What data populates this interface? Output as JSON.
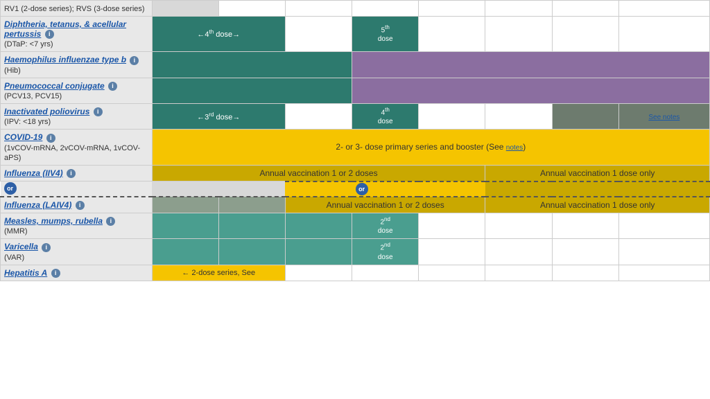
{
  "rows": [
    {
      "id": "rv",
      "vaccine_name": null,
      "vaccine_subtext": "RV1 (2-dose series); RVS (3-dose series)",
      "is_link": false,
      "cells": [
        {
          "bg": "grey-row",
          "text": "",
          "colspan": 1
        },
        {
          "bg": "empty",
          "text": "",
          "colspan": 1
        },
        {
          "bg": "empty",
          "text": "",
          "colspan": 1
        },
        {
          "bg": "empty",
          "text": "",
          "colspan": 1
        },
        {
          "bg": "empty",
          "text": "",
          "colspan": 1
        },
        {
          "bg": "empty",
          "text": "",
          "colspan": 1
        },
        {
          "bg": "empty",
          "text": "",
          "colspan": 1
        },
        {
          "bg": "empty",
          "text": "",
          "colspan": 1
        },
        {
          "bg": "empty",
          "text": "",
          "colspan": 1
        }
      ]
    },
    {
      "id": "dtap",
      "vaccine_name": "Diphtheria, tetanus, & acellular pertussis",
      "vaccine_subtext": "(DTaP: <7 yrs)",
      "is_link": true,
      "has_info": true,
      "cells": [
        {
          "bg": "teal-dark",
          "text": "←4th dose→",
          "colspan": 2,
          "extra_sup": "th",
          "extra_num": "4"
        },
        {
          "bg": "empty",
          "text": "",
          "colspan": 1
        },
        {
          "bg": "teal-dark",
          "text": "5th dose",
          "colspan": 1,
          "dose_label": true
        },
        {
          "bg": "empty",
          "text": "",
          "colspan": 1
        },
        {
          "bg": "empty",
          "text": "",
          "colspan": 1
        },
        {
          "bg": "empty",
          "text": "",
          "colspan": 1
        },
        {
          "bg": "empty",
          "text": "",
          "colspan": 1
        },
        {
          "bg": "empty",
          "text": "",
          "colspan": 1
        }
      ]
    },
    {
      "id": "hib",
      "vaccine_name": "Haemophilus influenzae type b",
      "vaccine_subtext": "(Hib)",
      "is_link": true,
      "has_info": true,
      "cells": [
        {
          "bg": "teal-dark",
          "text": "",
          "colspan": 3
        },
        {
          "bg": "purple",
          "text": "",
          "colspan": 6
        }
      ]
    },
    {
      "id": "pcv",
      "vaccine_name": "Pneumococcal conjugate",
      "vaccine_subtext": "(PCV13, PCV15)",
      "is_link": true,
      "has_info": true,
      "cells": [
        {
          "bg": "teal-dark",
          "text": "",
          "colspan": 3
        },
        {
          "bg": "purple",
          "text": "",
          "colspan": 6
        }
      ]
    },
    {
      "id": "ipv",
      "vaccine_name": "Inactivated poliovirus",
      "vaccine_subtext": "(IPV: <18 yrs)",
      "is_link": true,
      "has_info": true,
      "cells": [
        {
          "bg": "teal-dark",
          "text": "←3rd dose→",
          "colspan": 2
        },
        {
          "bg": "empty",
          "text": "",
          "colspan": 1
        },
        {
          "bg": "teal-dark",
          "text": "4th dose",
          "colspan": 1,
          "dose_label": true
        },
        {
          "bg": "empty",
          "text": "",
          "colspan": 1
        },
        {
          "bg": "empty",
          "text": "",
          "colspan": 1
        },
        {
          "bg": "grey-dark",
          "text": "",
          "colspan": 1
        },
        {
          "bg": "grey-dark",
          "text": "",
          "colspan": 1
        },
        {
          "bg": "grey-dark",
          "text": "See notes",
          "colspan": 1,
          "is_see_notes": true
        }
      ]
    },
    {
      "id": "covid",
      "vaccine_name": "COVID-19",
      "vaccine_subtext": "(1vCOV-mRNA, 2vCOV-mRNA, 1vCOV-aPS)",
      "is_link": true,
      "has_info": true,
      "cells": [
        {
          "bg": "yellow",
          "text": "2- or 3- dose primary series and booster (See notes)",
          "colspan": 9,
          "is_wide": true,
          "has_notes_link": true
        }
      ]
    },
    {
      "id": "influenza_iiv4",
      "vaccine_name": "Influenza (IIV4)",
      "vaccine_subtext": null,
      "is_link": true,
      "has_info": true,
      "cells": [
        {
          "bg": "gold",
          "text": "Annual vaccination 1 or 2 doses",
          "colspan": 5
        },
        {
          "bg": "gold",
          "text": "Annual vaccination 1 dose only",
          "colspan": 4
        }
      ]
    },
    {
      "id": "influenza_laiv4",
      "vaccine_name": "Influenza (LAIV4)",
      "vaccine_subtext": null,
      "is_link": true,
      "has_info": true,
      "is_dashed_top": true,
      "cells": [
        {
          "bg": "grey-med",
          "text": "",
          "colspan": 1
        },
        {
          "bg": "grey-med",
          "text": "",
          "colspan": 1
        },
        {
          "bg": "gold",
          "text": "Annual vaccination 1 or 2 doses",
          "colspan": 3,
          "has_or": true
        },
        {
          "bg": "gold",
          "text": "Annual vaccination 1 dose only",
          "colspan": 4
        }
      ]
    },
    {
      "id": "mmr",
      "vaccine_name": "Measles, mumps, rubella",
      "vaccine_subtext": "(MMR)",
      "is_link": true,
      "has_info": true,
      "cells": [
        {
          "bg": "teal-med",
          "text": "",
          "colspan": 1
        },
        {
          "bg": "teal-med",
          "text": "",
          "colspan": 1
        },
        {
          "bg": "teal-med",
          "text": "",
          "colspan": 1
        },
        {
          "bg": "teal-med",
          "text": "2nd dose",
          "colspan": 1,
          "dose_label": true
        },
        {
          "bg": "empty",
          "text": "",
          "colspan": 1
        },
        {
          "bg": "empty",
          "text": "",
          "colspan": 1
        },
        {
          "bg": "empty",
          "text": "",
          "colspan": 1
        },
        {
          "bg": "empty",
          "text": "",
          "colspan": 1
        },
        {
          "bg": "empty",
          "text": "",
          "colspan": 1
        }
      ]
    },
    {
      "id": "varicella",
      "vaccine_name": "Varicella",
      "vaccine_subtext": "(VAR)",
      "is_link": true,
      "has_info": true,
      "cells": [
        {
          "bg": "teal-med",
          "text": "",
          "colspan": 1
        },
        {
          "bg": "teal-med",
          "text": "",
          "colspan": 1
        },
        {
          "bg": "teal-med",
          "text": "",
          "colspan": 1
        },
        {
          "bg": "teal-med",
          "text": "2nd dose",
          "colspan": 1,
          "dose_label": true
        },
        {
          "bg": "empty",
          "text": "",
          "colspan": 1
        },
        {
          "bg": "empty",
          "text": "",
          "colspan": 1
        },
        {
          "bg": "empty",
          "text": "",
          "colspan": 1
        },
        {
          "bg": "empty",
          "text": "",
          "colspan": 1
        },
        {
          "bg": "empty",
          "text": "",
          "colspan": 1
        }
      ]
    },
    {
      "id": "hepa",
      "vaccine_name": "Hepatitis A",
      "vaccine_subtext": null,
      "is_link": true,
      "has_info": true,
      "cells": [
        {
          "bg": "yellow",
          "text": "← 2-dose series, See",
          "colspan": 2
        },
        {
          "bg": "empty",
          "text": "",
          "colspan": 7
        }
      ]
    }
  ],
  "labels": {
    "see_notes": "See notes",
    "notes": "notes",
    "or_text": "or",
    "annual_1_2": "Annual vaccination 1 or 2 doses",
    "annual_1": "Annual vaccination 1 dose only",
    "two_dose_series": "← 2-dose series, See",
    "covid_text": "2- or 3- dose primary series and booster (See ",
    "covid_notes": "notes",
    "covid_close": ")"
  }
}
